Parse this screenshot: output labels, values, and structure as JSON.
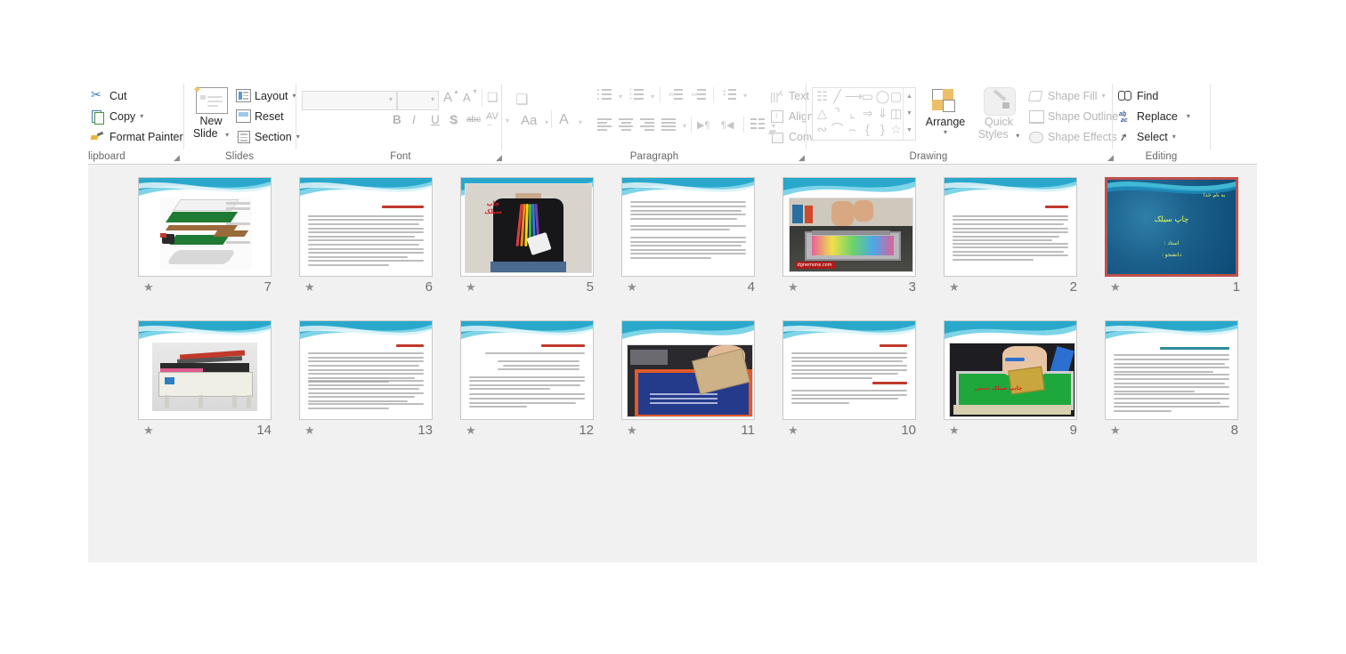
{
  "app": {
    "name": "PowerPoint Slide Sorter"
  },
  "ribbon": {
    "groups": [
      {
        "name": "Clipboard",
        "label": "lipboard"
      },
      {
        "name": "Slides",
        "label": "Slides"
      },
      {
        "name": "Font",
        "label": "Font"
      },
      {
        "name": "Paragraph",
        "label": "Paragraph"
      },
      {
        "name": "Drawing",
        "label": "Drawing"
      },
      {
        "name": "Editing",
        "label": "Editing"
      }
    ],
    "clipboard": {
      "cut": "Cut",
      "copy": "Copy",
      "format_painter": "Format Painter"
    },
    "slides": {
      "new_slide_line1": "New",
      "new_slide_line2": "Slide",
      "layout": "Layout",
      "reset": "Reset",
      "section": "Section"
    },
    "font": {
      "font_name_value": "",
      "font_size_value": "",
      "grow_font": "A",
      "shrink_font": "A",
      "clear_formatting": "clear-formatting",
      "bold": "B",
      "italic": "I",
      "underline": "U",
      "shadow": "S",
      "strikethrough": "abc",
      "character_spacing": "AV",
      "change_case": "Aa",
      "font_color": "A"
    },
    "paragraph": {
      "text_direction": "Text Direction",
      "align_text": "Align Text",
      "convert_to_smartart": "Convert to SmartArt"
    },
    "drawing": {
      "arrange": "Arrange",
      "quick_styles_line1": "Quick",
      "quick_styles_line2": "Styles",
      "shape_fill": "Shape Fill",
      "shape_outline": "Shape Outline",
      "shape_effects": "Shape Effects"
    },
    "editing": {
      "find": "Find",
      "replace": "Replace",
      "select": "Select"
    },
    "collapse_ribbon": "collapse-ribbon"
  },
  "sorter": {
    "slides": [
      {
        "number": "7",
        "star": "★",
        "kind": "diagram",
        "heading": "",
        "selected": false
      },
      {
        "number": "6",
        "star": "★",
        "kind": "text-red",
        "heading": "عیب سیلک روی پارچه",
        "selected": false
      },
      {
        "number": "5",
        "star": "★",
        "kind": "tshirt",
        "heading": "چاپ سیلک",
        "selected": false
      },
      {
        "number": "4",
        "star": "★",
        "kind": "text",
        "heading": "",
        "selected": false
      },
      {
        "number": "3",
        "star": "★",
        "kind": "press",
        "heading": "dgnemone.com",
        "selected": false
      },
      {
        "number": "2",
        "star": "★",
        "kind": "text-red",
        "heading": "چاپ سیلک",
        "selected": false
      },
      {
        "number": "1",
        "star": "★",
        "kind": "title",
        "heading": "چاپ سیلک",
        "selected": true
      },
      {
        "number": "14",
        "star": "★",
        "kind": "machine",
        "heading": "",
        "selected": false
      },
      {
        "number": "13",
        "star": "★",
        "kind": "text-red",
        "heading": "مواد چاپی",
        "selected": false
      },
      {
        "number": "12",
        "star": "★",
        "kind": "text-red",
        "heading": "فرایند چاپ سیلک دستی",
        "selected": false
      },
      {
        "number": "11",
        "star": "★",
        "kind": "blueprint",
        "heading": "",
        "selected": false
      },
      {
        "number": "10",
        "star": "★",
        "kind": "text-red2",
        "heading": "چاپ سیلک دستی",
        "selected": false
      },
      {
        "number": "9",
        "star": "★",
        "kind": "green",
        "heading": "چاپ سیلک دستی",
        "selected": false
      },
      {
        "number": "8",
        "star": "★",
        "kind": "text-teal",
        "heading": "انواع چاپ سیلک",
        "selected": false
      }
    ]
  },
  "title_slide": {
    "line1": "به نام خدا",
    "title": "چاپ سیلک",
    "line3": "استاد :",
    "line4": "دانشجو :"
  },
  "slide5_text": {
    "line1": "چاپ",
    "line2": "سیلک"
  },
  "slide9_text": {
    "line1": "چاپی سیلک دستی"
  },
  "slide3_watermark": {
    "text": "dgnemone.com"
  },
  "colors": {
    "selection_border": "#C0504D",
    "workspace_bg": "#F1F1F1",
    "ribbon_bg": "#FFFFFF",
    "disabled_text": "#B6B6B6",
    "enabled_text": "#262626",
    "group_label": "#666666",
    "slide_number": "#6F6F6F",
    "accent_teal": "#2E8B9A",
    "accent_red": "#C0392B"
  }
}
